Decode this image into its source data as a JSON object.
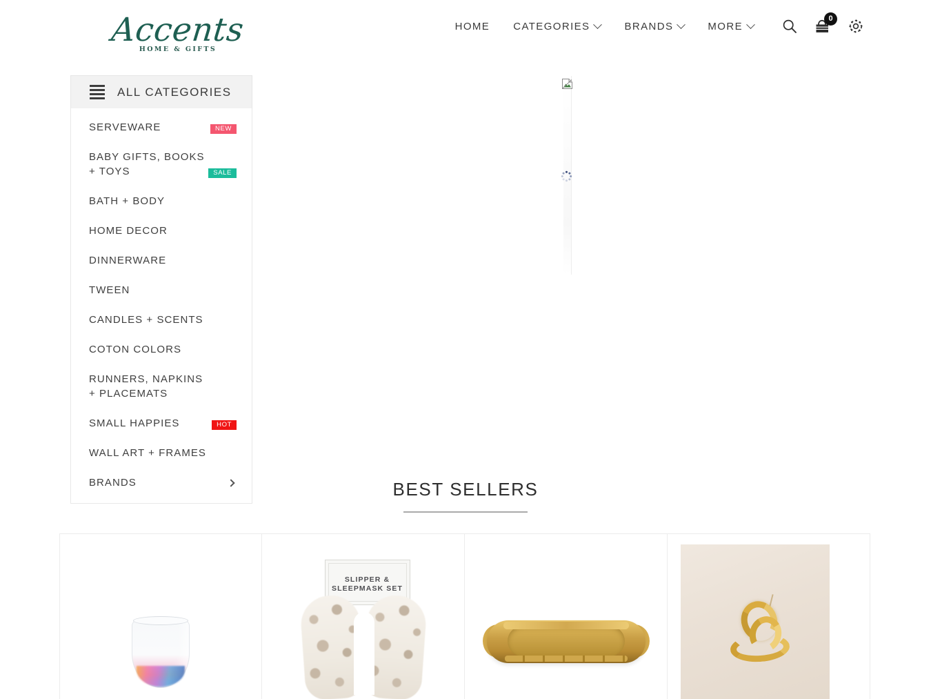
{
  "header": {
    "logo": {
      "name": "Accents",
      "tagline": "HOME & GIFTS"
    },
    "nav": [
      {
        "label": "HOME",
        "has_dropdown": false
      },
      {
        "label": "CATEGORIES",
        "has_dropdown": true
      },
      {
        "label": "BRANDS",
        "has_dropdown": true
      },
      {
        "label": "MORE",
        "has_dropdown": true
      }
    ],
    "icons": {
      "search": "search-icon",
      "cart": "cart-icon",
      "cart_count": "0",
      "settings": "gear-icon"
    }
  },
  "categories_panel": {
    "title": "ALL CATEGORIES",
    "menu_icon": "hamburger-icon",
    "items": [
      {
        "label": "SERVEWARE",
        "badge": "NEW",
        "badge_type": "new",
        "submenu": false
      },
      {
        "label": "BABY GIFTS, BOOKS + TOYS",
        "badge": "SALE",
        "badge_type": "sale",
        "submenu": false
      },
      {
        "label": "BATH + BODY",
        "badge": "",
        "badge_type": "",
        "submenu": false
      },
      {
        "label": "HOME DECOR",
        "badge": "",
        "badge_type": "",
        "submenu": false
      },
      {
        "label": "DINNERWARE",
        "badge": "",
        "badge_type": "",
        "submenu": false
      },
      {
        "label": "TWEEN",
        "badge": "",
        "badge_type": "",
        "submenu": false
      },
      {
        "label": "CANDLES + SCENTS",
        "badge": "",
        "badge_type": "",
        "submenu": false
      },
      {
        "label": "COTON COLORS",
        "badge": "",
        "badge_type": "",
        "submenu": false
      },
      {
        "label": "RUNNERS, NAPKINS + PLACEMATS",
        "badge": "",
        "badge_type": "",
        "submenu": false
      },
      {
        "label": "SMALL HAPPIES",
        "badge": "HOT",
        "badge_type": "hot",
        "submenu": false
      },
      {
        "label": "WALL ART + FRAMES",
        "badge": "",
        "badge_type": "",
        "submenu": false
      },
      {
        "label": "BRANDS",
        "badge": "",
        "badge_type": "",
        "submenu": true
      }
    ],
    "colors": {
      "badge_new": "#f4566f",
      "badge_sale": "#1bbc9b",
      "badge_hot": "#f01414",
      "header_bg": "#f2f2f2"
    }
  },
  "slider": {
    "state": "loading",
    "broken_image_icon": "broken-image-icon",
    "spinner_icon": "loading-spinner-icon"
  },
  "best_sellers": {
    "title": "BEST SELLERS",
    "products": [
      {
        "name": "iridescent-stemless-wine-glass",
        "caption": ""
      },
      {
        "name": "slipper-and-sleepmask-set",
        "caption": "SLIPPER &\nSLEEPMASK SET",
        "card_line1": "SLIPPER &",
        "card_line2": "SLEEPMASK SET"
      },
      {
        "name": "gold-bamboo-oval-tray",
        "caption": ""
      },
      {
        "name": "gold-hoop-earrings",
        "caption": ""
      }
    ]
  }
}
